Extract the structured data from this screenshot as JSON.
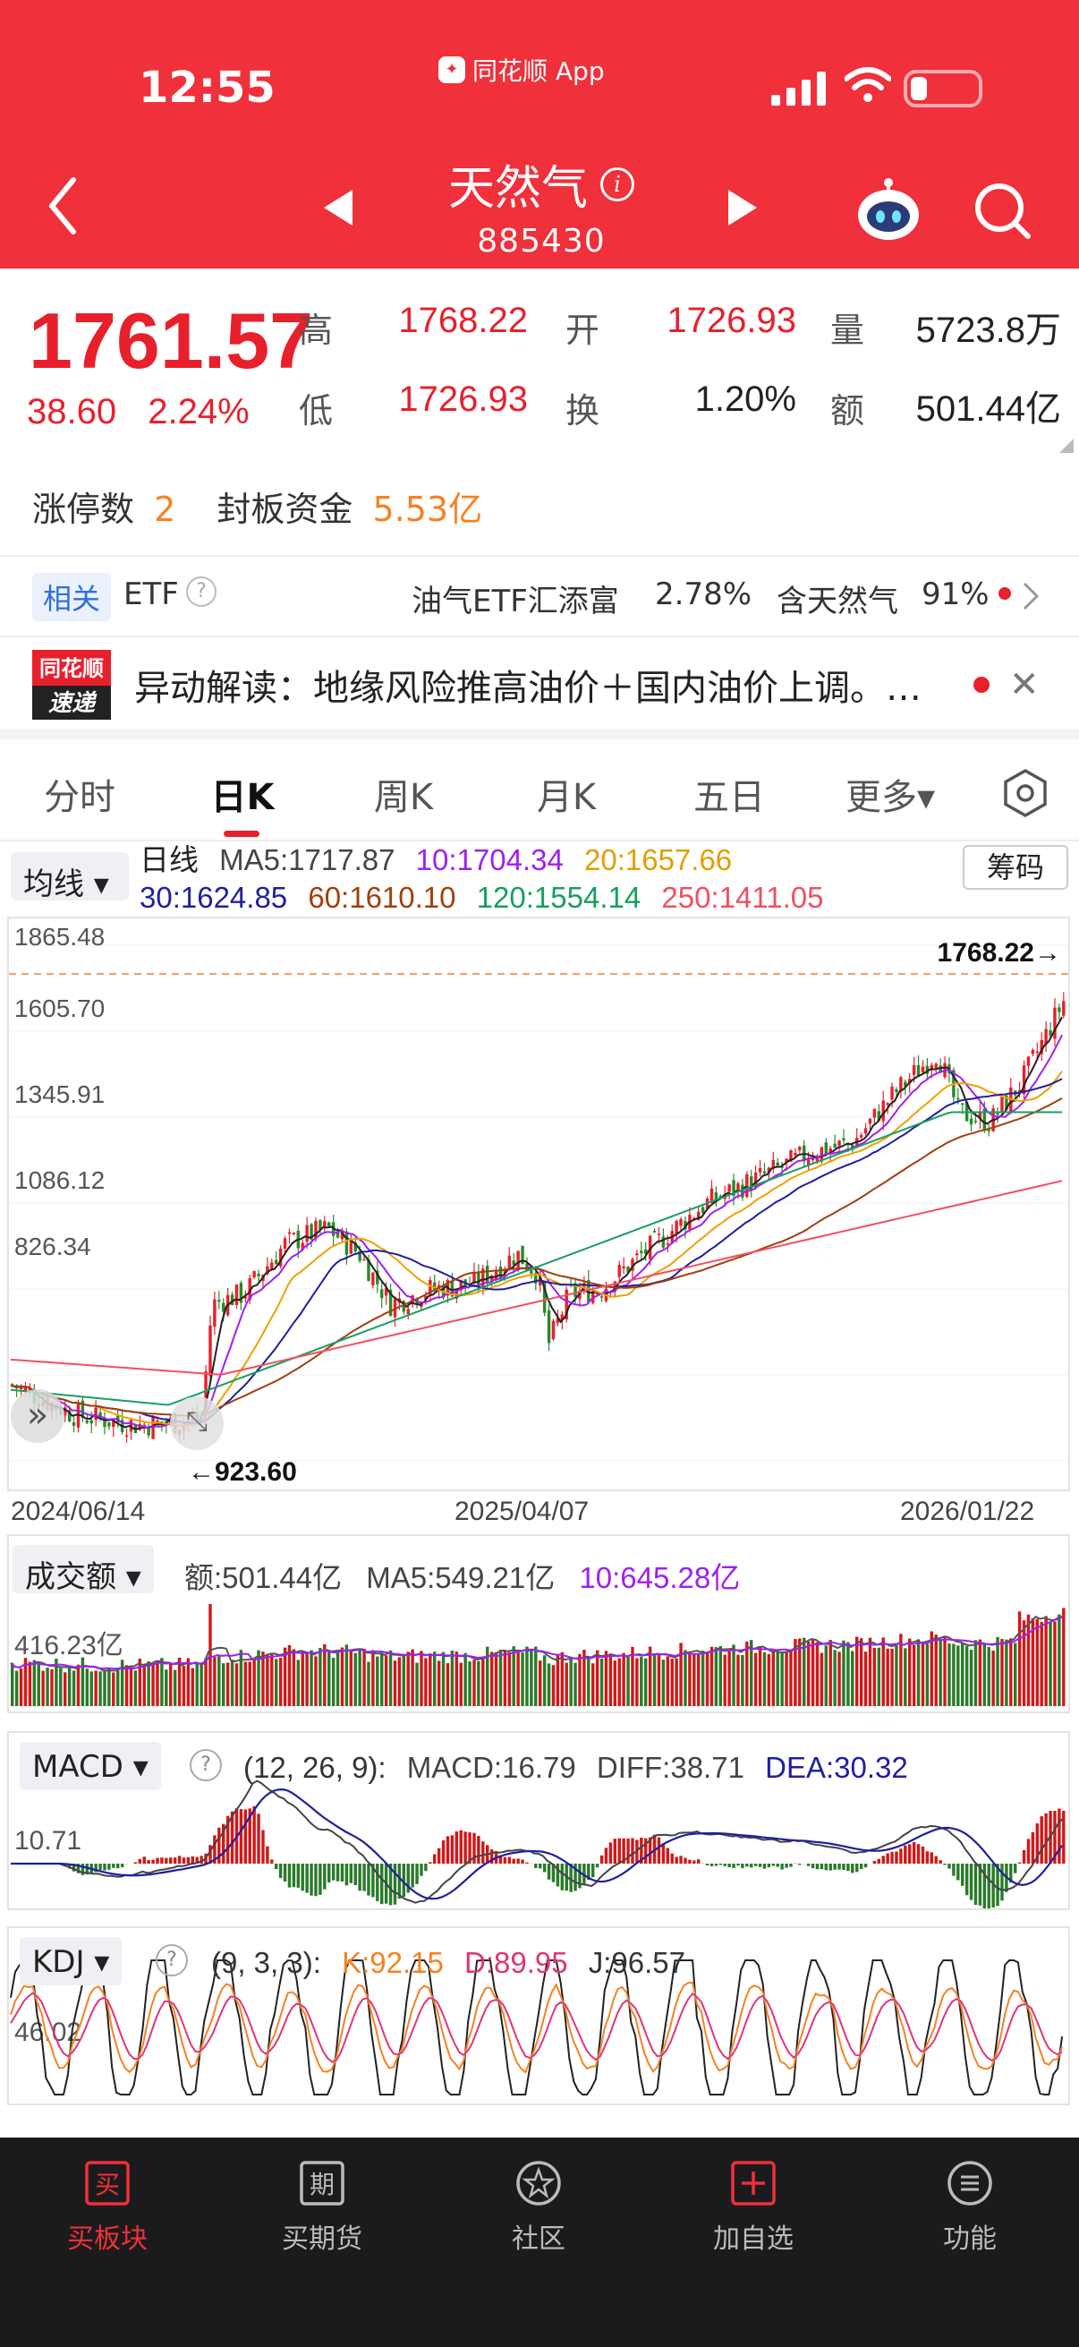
{
  "status": {
    "time": "12:55",
    "app_name": "同花顺 App"
  },
  "header": {
    "title": "天然气",
    "code": "885430"
  },
  "quote": {
    "price": "1761.57",
    "change": "38.60",
    "change_pct": "2.24%",
    "high_label": "高",
    "high": "1768.22",
    "low_label": "低",
    "low": "1726.93",
    "open_label": "开",
    "open": "1726.93",
    "turnover_label": "换",
    "turnover": "1.20%",
    "volume_label": "量",
    "volume": "5723.8万",
    "amount_label": "额",
    "amount": "501.44亿",
    "limit_up_label": "涨停数",
    "limit_up_count": "2",
    "seal_fund_label": "封板资金",
    "seal_fund": "5.53亿"
  },
  "etf": {
    "badge": "相关",
    "label": "ETF",
    "fund_name": "油气ETF汇添富",
    "fund_change": "2.78%",
    "contains_label": "含天然气",
    "contains_pct": "91%"
  },
  "news": {
    "logo_top": "同花顺",
    "logo_bottom": "速递",
    "text": "异动解读：地缘风险推高油价＋国内油价上调。…"
  },
  "tabs": [
    "分时",
    "日K",
    "周K",
    "月K",
    "五日",
    "更多▾"
  ],
  "chart_controls": {
    "ma_select": "均线 ▾",
    "chip_button": "筹码"
  },
  "ma_legend": {
    "line_label": "日线",
    "ma5": "MA5:1717.87",
    "ma10": "10:1704.34",
    "ma20": "20:1657.66",
    "ma30": "30:1624.85",
    "ma60": "60:1610.10",
    "ma120": "120:1554.14",
    "ma250": "250:1411.05"
  },
  "kchart": {
    "y_ticks": [
      "1865.48",
      "1605.70",
      "1345.91",
      "1086.12",
      "826.34"
    ],
    "max_label": "1768.22→",
    "min_label": "←923.60",
    "dates": [
      "2024/06/14",
      "2025/04/07",
      "2026/01/22"
    ]
  },
  "volume_panel": {
    "select": "成交额 ▾",
    "amount": "额:501.44亿",
    "ma5": "MA5:549.21亿",
    "ma10": "10:645.28亿",
    "y_tick": "416.23亿"
  },
  "macd_panel": {
    "select": "MACD ▾",
    "params": "(12, 26, 9):",
    "macd": "MACD:16.79",
    "diff": "DIFF:38.71",
    "dea": "DEA:30.32",
    "y_tick": "10.71"
  },
  "kdj_panel": {
    "select": "KDJ ▾",
    "params": "(9, 3, 3):",
    "k": "K:92.15",
    "d": "D:89.95",
    "j": "J:96.57",
    "y_tick": "46.02"
  },
  "bottom_nav": [
    {
      "label": "买板块",
      "icon": "buy-icon"
    },
    {
      "label": "买期货",
      "icon": "futures-icon"
    },
    {
      "label": "社区",
      "icon": "community-icon"
    },
    {
      "label": "加自选",
      "icon": "add-watchlist-icon"
    },
    {
      "label": "功能",
      "icon": "menu-icon"
    }
  ],
  "colors": {
    "brand_red": "#f0303a",
    "up": "#e8202c",
    "down": "#2a8a2a",
    "ma5": "#222222",
    "ma10": "#a020f0",
    "ma20": "#f0a000",
    "ma30": "#1f1fa0",
    "ma60": "#a0400f",
    "ma120": "#16a060",
    "ma250": "#f05060"
  }
}
